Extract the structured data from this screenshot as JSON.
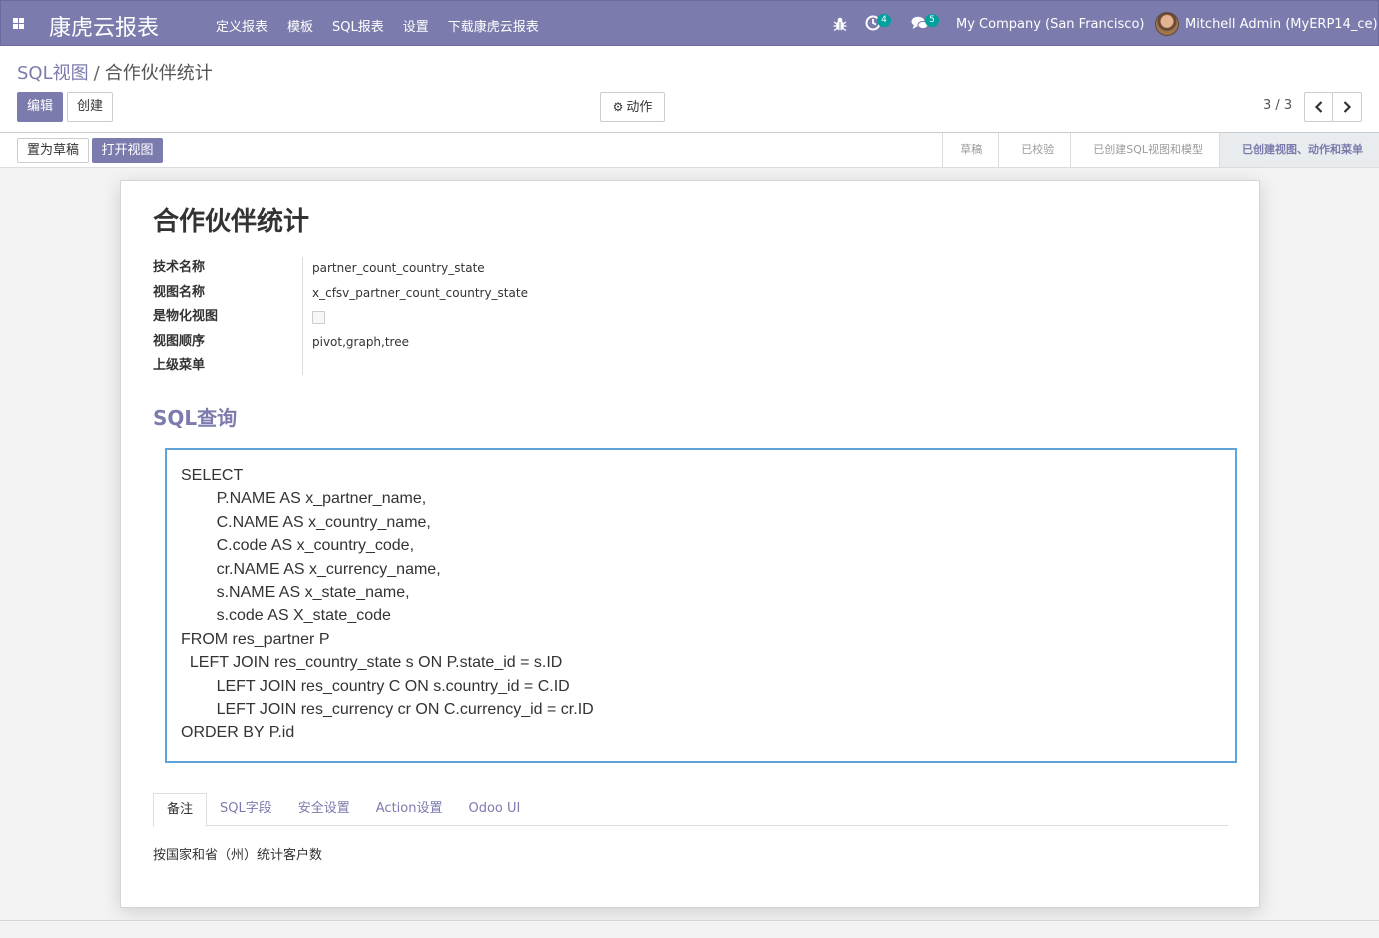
{
  "app": {
    "brand": "康虎云报表",
    "menu": [
      "定义报表",
      "模板",
      "SQL报表",
      "设置",
      "下载康虎云报表"
    ],
    "activity_count": "4",
    "message_count": "5",
    "company": "My Company (San Francisco)",
    "user": "Mitchell Admin (MyERP14_ce)",
    "accent_color": "#7c7bad",
    "badge_color": "#00a09d"
  },
  "control_panel": {
    "breadcrumb_parent": "SQL视图",
    "breadcrumb_separator": "/",
    "breadcrumb_current": "合作伙伴统计",
    "edit_label": "编辑",
    "create_label": "创建",
    "action_label": "动作",
    "pager": "3 / 3"
  },
  "statusbar": {
    "draft_label": "置为草稿",
    "open_view_label": "打开视图",
    "stages": [
      "草稿",
      "已校验",
      "已创建SQL视图和模型",
      "已创建视图、动作和菜单"
    ],
    "active_stage": "已创建视图、动作和菜单"
  },
  "form": {
    "title": "合作伙伴统计",
    "fields": [
      {
        "label": "技术名称",
        "value": "partner_count_country_state"
      },
      {
        "label": "视图名称",
        "value": "x_cfsv_partner_count_country_state"
      },
      {
        "label": "是物化视图",
        "value": "",
        "checked": false
      },
      {
        "label": "视图顺序",
        "value": "pivot,graph,tree"
      },
      {
        "label": "上级菜单",
        "value": ""
      }
    ],
    "sql_heading": "SQL查询",
    "sql_lines": [
      "SELECT",
      "        P.NAME AS x_partner_name,",
      "        C.NAME AS x_country_name,",
      "        C.code AS x_country_code,",
      "        cr.NAME AS x_currency_name,",
      "        s.NAME AS x_state_name,",
      "        s.code AS X_state_code",
      "FROM res_partner P",
      "  LEFT JOIN res_country_state s ON P.state_id = s.ID",
      "        LEFT JOIN res_country C ON s.country_id = C.ID",
      "        LEFT JOIN res_currency cr ON C.currency_id = cr.ID",
      "ORDER BY P.id"
    ],
    "tabs": [
      "备注",
      "SQL字段",
      "安全设置",
      "Action设置",
      "Odoo UI"
    ],
    "active_tab": "备注",
    "note": "按国家和省（州）统计客户数"
  }
}
